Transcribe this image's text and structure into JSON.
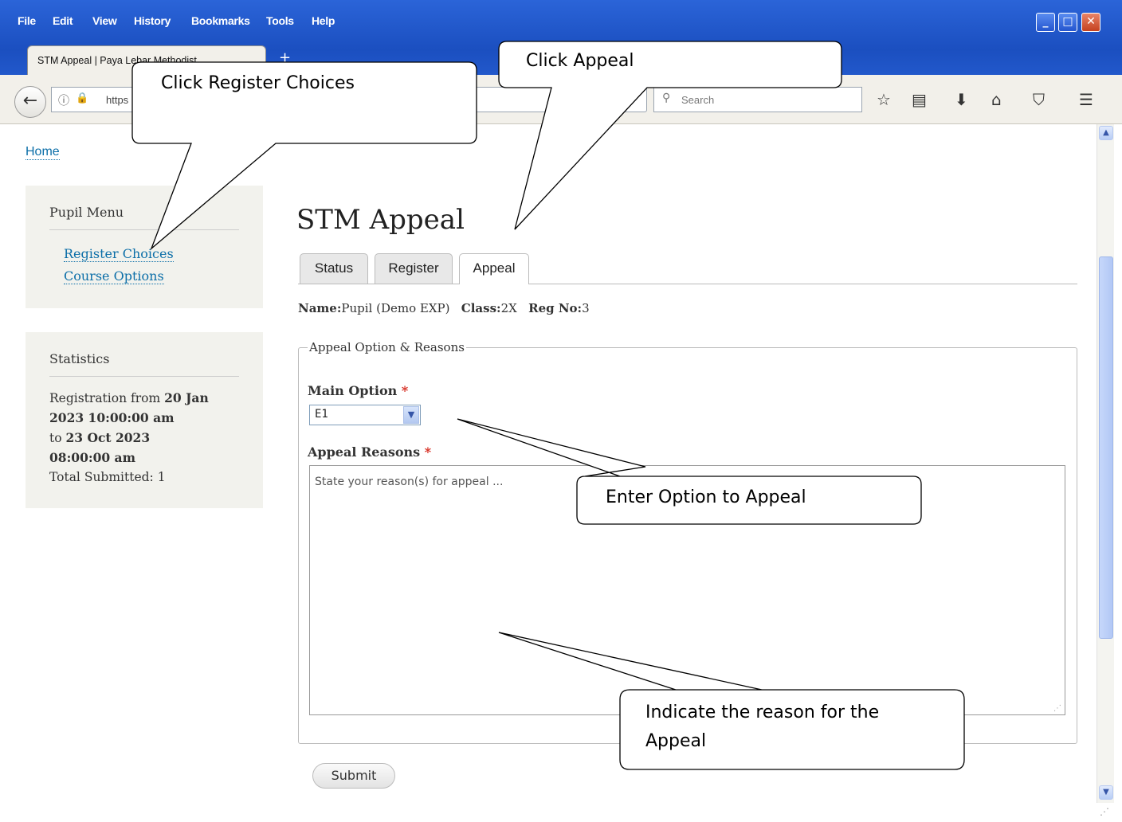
{
  "browser": {
    "menu": [
      "File",
      "Edit",
      "View",
      "History",
      "Bookmarks",
      "Tools",
      "Help"
    ],
    "tab_title": "STM Appeal | Paya Lebar Methodist...",
    "url": "https",
    "search_placeholder": "Search"
  },
  "page": {
    "breadcrumb_home": "Home",
    "pupil_menu": {
      "title": "Pupil Menu",
      "links": [
        "Register Choices",
        "Course Options"
      ]
    },
    "statistics": {
      "title": "Statistics",
      "reg_prefix": "Registration from",
      "reg_from_1": "20 Jan",
      "reg_from_2": "2023 10:00:00 am",
      "to_prefix": "to",
      "reg_to_1": "23 Oct 2023",
      "reg_to_2": "08:00:00 am",
      "total_submitted": "Total Submitted: 1"
    },
    "title": "STM Appeal",
    "tabs": [
      "Status",
      "Register",
      "Appeal"
    ],
    "active_tab": "Appeal",
    "info": {
      "name_label": "Name:",
      "name_value": "Pupil (Demo EXP)",
      "class_label": "Class:",
      "class_value": "2X",
      "reg_label": "Reg No:",
      "reg_value": "3"
    },
    "fieldset_legend": "Appeal Option & Reasons",
    "main_option_label": "Main Option",
    "main_option_value": "E1",
    "appeal_reasons_label": "Appeal Reasons",
    "appeal_reasons_placeholder": "State your reason(s) for appeal ...",
    "required_mark": "*",
    "submit_label": "Submit"
  },
  "callouts": {
    "register": "Click Register Choices",
    "appeal": "Click Appeal",
    "option": "Enter Option to Appeal",
    "reason_1": "Indicate the reason for the",
    "reason_2": "Appeal"
  },
  "colors": {
    "link": "#0b6ea8",
    "required": "#d62b1f",
    "titlebar": "#2b64d8"
  }
}
